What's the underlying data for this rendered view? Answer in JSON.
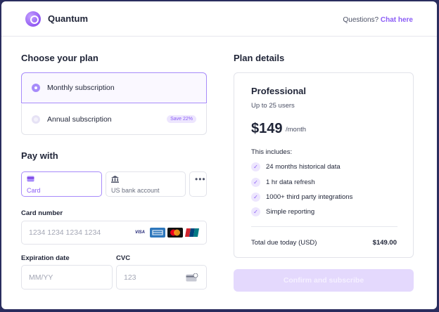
{
  "header": {
    "brand": "Quantum",
    "questions_text": "Questions?",
    "chat_link": "Chat here"
  },
  "plan": {
    "heading": "Choose your plan",
    "options": [
      {
        "label": "Monthly subscription",
        "selected": true
      },
      {
        "label": "Annual subscription",
        "selected": false,
        "badge": "Save 22%"
      }
    ]
  },
  "pay": {
    "heading": "Pay with",
    "methods": [
      {
        "label": "Card",
        "icon": "credit-card-icon",
        "selected": true
      },
      {
        "label": "US bank account",
        "icon": "bank-icon",
        "selected": false
      },
      {
        "label": "",
        "icon": "more-dots-icon",
        "selected": false
      }
    ]
  },
  "card": {
    "number_label": "Card number",
    "number_placeholder": "1234 1234 1234 1234",
    "brands": [
      "VISA",
      "AMEX",
      "Mastercard",
      "UnionPay"
    ],
    "expiry_label": "Expiration date",
    "expiry_placeholder": "MM/YY",
    "cvc_label": "CVC",
    "cvc_placeholder": "123"
  },
  "details": {
    "heading": "Plan details",
    "plan_name": "Professional",
    "users": "Up to 25 users",
    "price": "$149",
    "period": "/month",
    "includes_label": "This includes:",
    "features": [
      "24 months historical data",
      "1 hr data refresh",
      "1000+ third party integrations",
      "Simple reporting"
    ],
    "total_label": "Total due today (USD)",
    "total_value": "$149.00"
  },
  "confirm_label": "Confirm and subscribe",
  "colors": {
    "accent": "#8b5cf6",
    "accent_light": "#a78bfa",
    "confirm_disabled": "#e4d9fd"
  }
}
